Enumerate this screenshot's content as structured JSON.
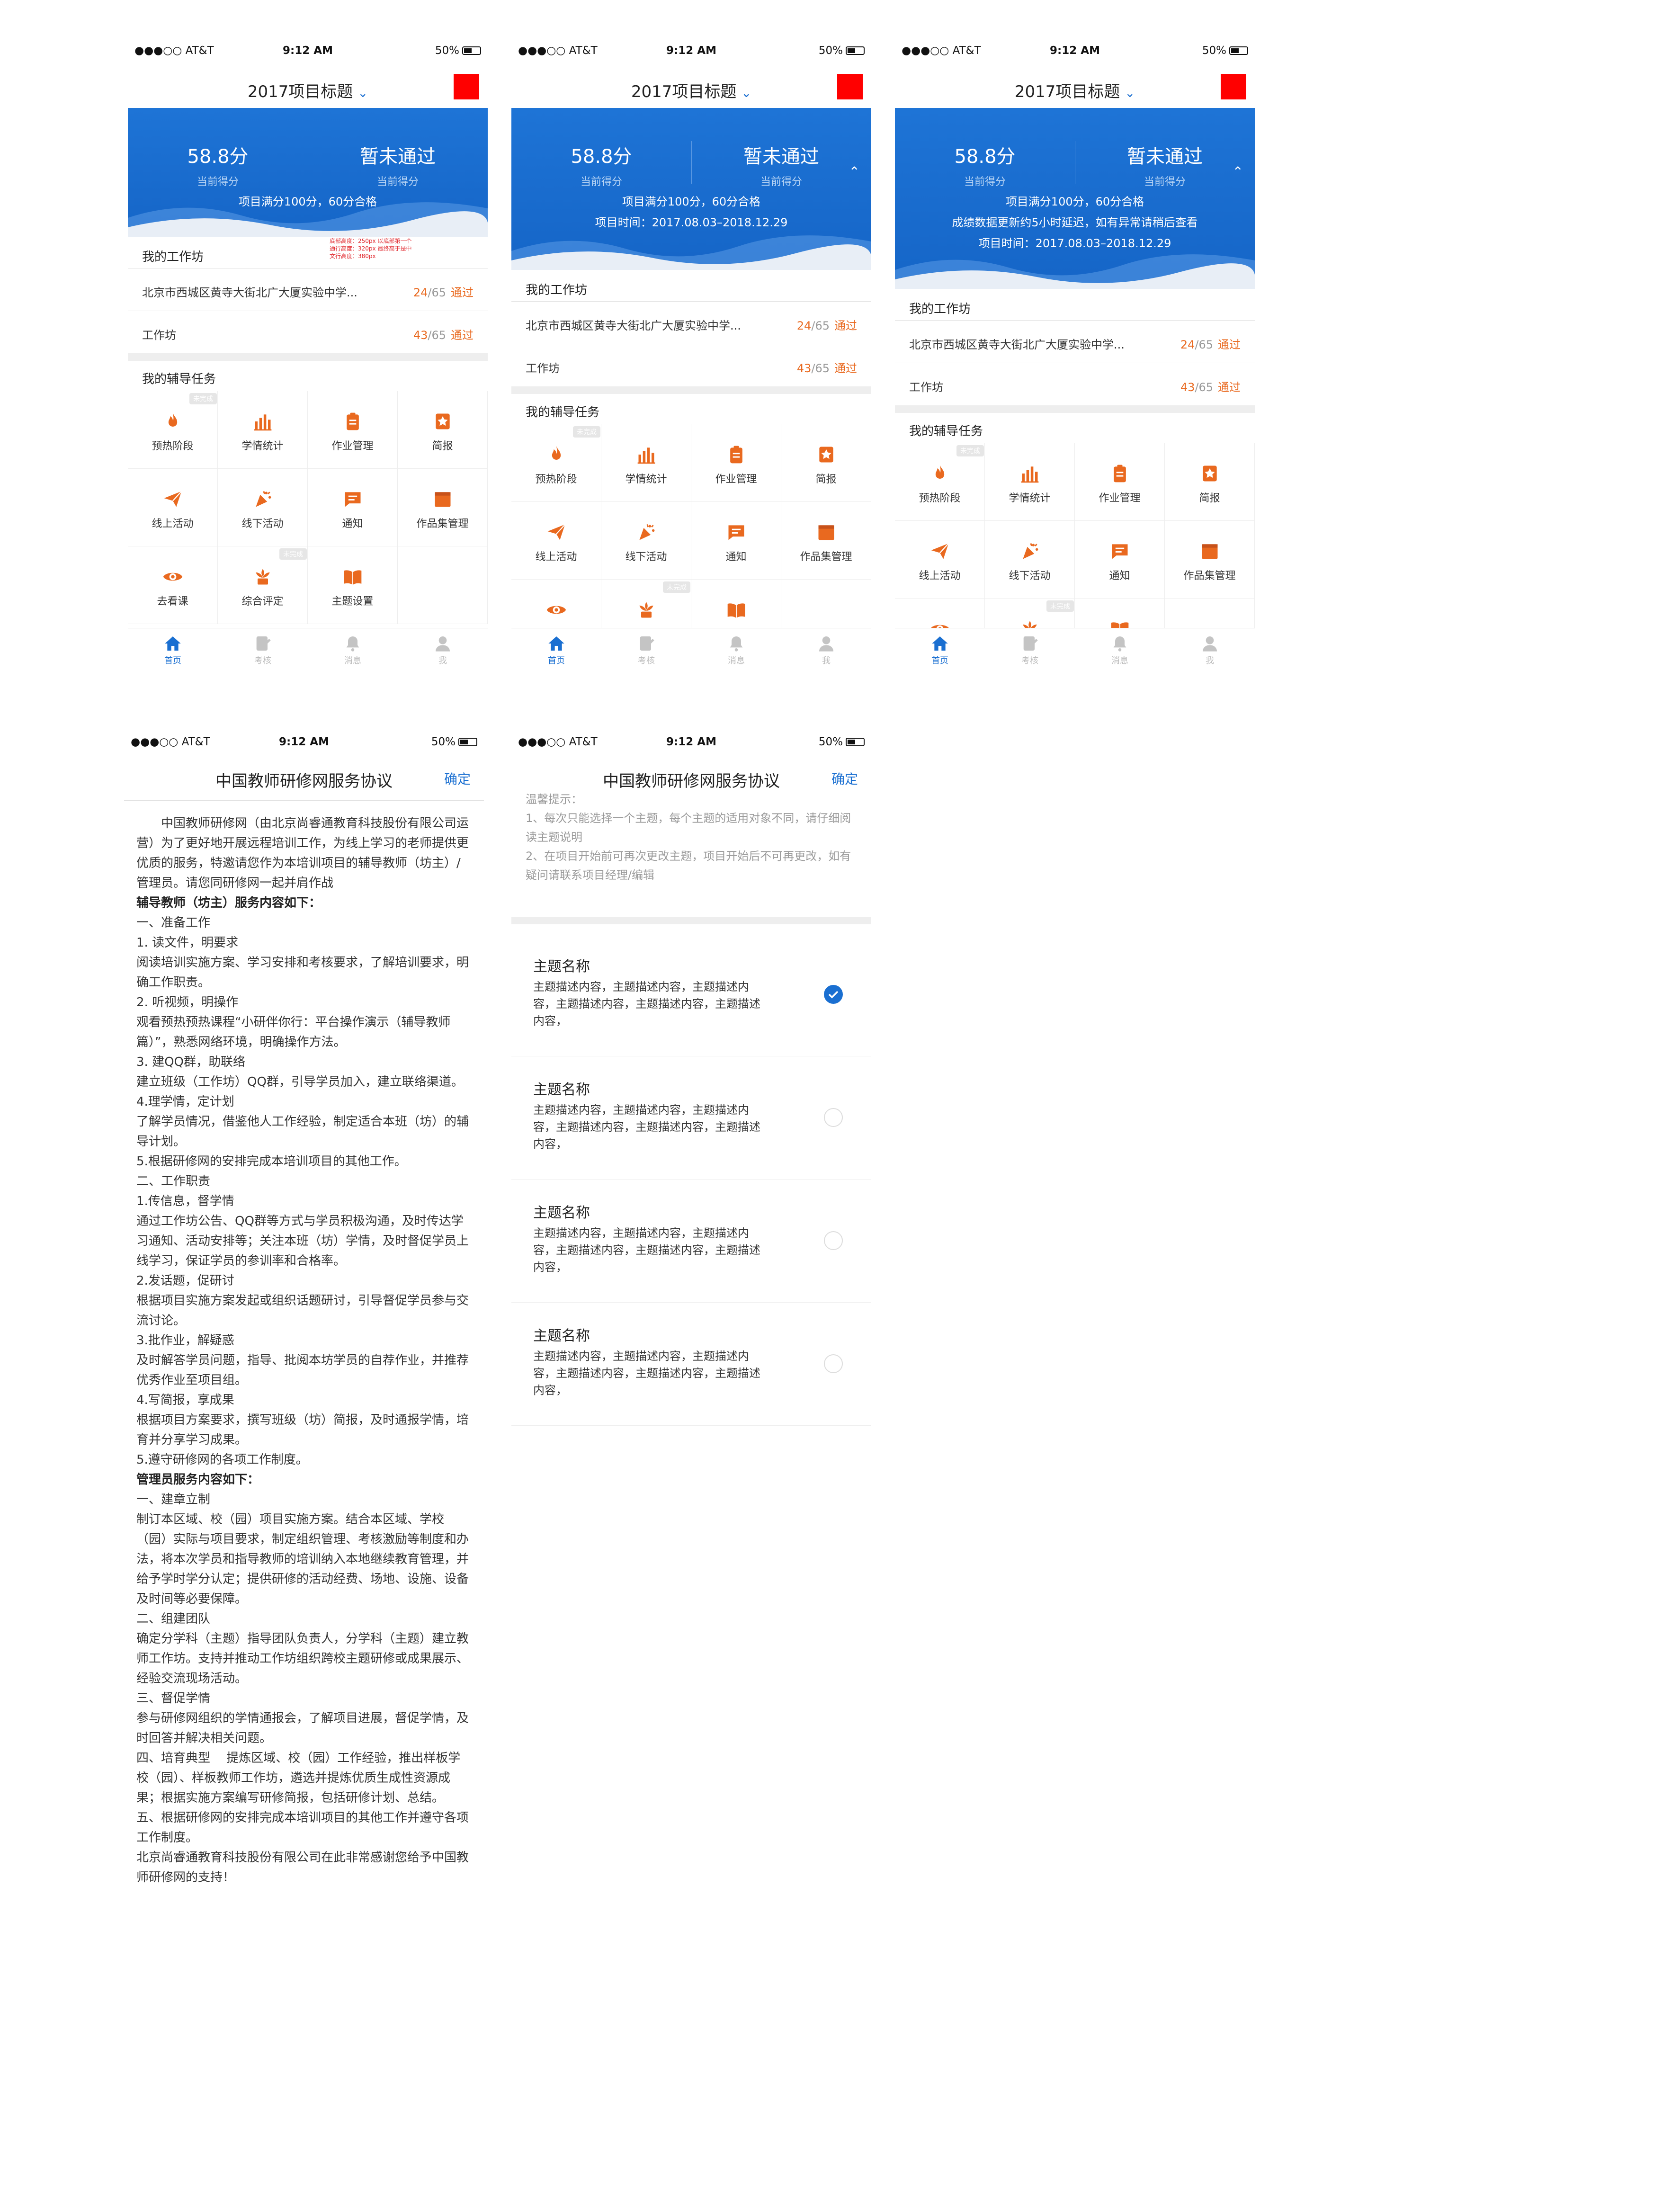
{
  "status": {
    "carrier": "●●●○○ AT&T",
    "time": "9:12 AM",
    "battery": "50%"
  },
  "home": {
    "title": "2017项目标题",
    "score_value": "58.8分",
    "score_label": "当前得分",
    "status_value": "暂未通过",
    "status_label": "当前得分",
    "info_full": "项目满分100分，60分合格",
    "info_time": "项目时间：2017.08.03–2018.12.29",
    "info_delay": "成绩数据更新约5小时延迟，如有异常请稍后查看",
    "workshop_title": "我的工作坊",
    "workshop_rows": [
      {
        "name": "北京市西城区黄寺大街北广大厦实验中学...",
        "score": "24",
        "total": "/65",
        "status": "通过"
      },
      {
        "name": "工作坊",
        "score": "43",
        "total": "/65",
        "status": "通过"
      }
    ],
    "tasks_title": "我的辅导任务",
    "tasks": [
      {
        "label": "预热阶段",
        "icon": "fire-icon"
      },
      {
        "label": "学情统计",
        "icon": "bar-chart-icon"
      },
      {
        "label": "作业管理",
        "icon": "clipboard-icon"
      },
      {
        "label": "简报",
        "icon": "star-bookmark-icon"
      },
      {
        "label": "线上活动",
        "icon": "paper-plane-icon"
      },
      {
        "label": "线下活动",
        "icon": "party-popper-icon"
      },
      {
        "label": "通知",
        "icon": "message-icon"
      },
      {
        "label": "作品集管理",
        "icon": "folder-icon"
      },
      {
        "label": "去看课",
        "icon": "eye-icon"
      },
      {
        "label": "综合评定",
        "icon": "flower-icon"
      },
      {
        "label": "主题设置",
        "icon": "book-icon"
      }
    ],
    "badge": "未完成",
    "tabs": [
      {
        "label": "首页",
        "icon": "home-icon"
      },
      {
        "label": "考核",
        "icon": "edit-icon"
      },
      {
        "label": "消息",
        "icon": "bell-icon"
      },
      {
        "label": "我",
        "icon": "user-icon"
      }
    ]
  },
  "agreement": {
    "title": "中国教师研修网服务协议",
    "confirm": "确定",
    "paragraphs": [
      {
        "text": "　　中国教师研修网（由北京尚睿通教育科技股份有限公司运营）为了更好地开展远程培训工作，为线上学习的老师提供更优质的服务，特邀请您作为本培训项目的辅导教师（坊主）/管理员。请您同研修网一起并肩作战",
        "bold": false
      },
      {
        "text": "辅导教师（坊主）服务内容如下：",
        "bold": true
      },
      {
        "text": "一、准备工作",
        "bold": false
      },
      {
        "text": "1. 读文件，明要求",
        "bold": false
      },
      {
        "text": "阅读培训实施方案、学习安排和考核要求，了解培训要求，明确工作职责。",
        "bold": false
      },
      {
        "text": "2. 听视频，明操作",
        "bold": false
      },
      {
        "text": "观看预热预热课程“小研伴你行：平台操作演示（辅导教师篇）”，熟悉网络环境，明确操作方法。",
        "bold": false
      },
      {
        "text": "3. 建QQ群，助联络",
        "bold": false
      },
      {
        "text": "建立班级（工作坊）QQ群，引导学员加入，建立联络渠道。",
        "bold": false
      },
      {
        "text": "4.理学情，定计划",
        "bold": false
      },
      {
        "text": "了解学员情况，借鉴他人工作经验，制定适合本班（坊）的辅导计划。",
        "bold": false
      },
      {
        "text": "5.根据研修网的安排完成本培训项目的其他工作。",
        "bold": false
      },
      {
        "text": "二、工作职责",
        "bold": false
      },
      {
        "text": "1.传信息，督学情",
        "bold": false
      },
      {
        "text": "通过工作坊公告、QQ群等方式与学员积极沟通，及时传达学习通知、活动安排等；关注本班（坊）学情，及时督促学员上线学习，保证学员的参训率和合格率。",
        "bold": false
      },
      {
        "text": "2.发话题，促研讨",
        "bold": false
      },
      {
        "text": "根据项目实施方案发起或组织话题研讨，引导督促学员参与交流讨论。",
        "bold": false
      },
      {
        "text": "3.批作业，解疑惑",
        "bold": false
      },
      {
        "text": "及时解答学员问题，指导、批阅本坊学员的自荐作业，并推荐优秀作业至项目组。",
        "bold": false
      },
      {
        "text": "4.写简报，享成果",
        "bold": false
      },
      {
        "text": "根据项目方案要求，撰写班级（坊）简报，及时通报学情，培育并分享学习成果。",
        "bold": false
      },
      {
        "text": "5.遵守研修网的各项工作制度。",
        "bold": false
      },
      {
        "text": "管理员服务内容如下：",
        "bold": true
      },
      {
        "text": "一、建章立制",
        "bold": false
      },
      {
        "text": "制订本区域、校（园）项目实施方案。结合本区域、学校（园）实际与项目要求，制定组织管理、考核激励等制度和办法，将本次学员和指导教师的培训纳入本地继续教育管理，并给予学时学分认定；提供研修的活动经费、场地、设施、设备及时间等必要保障。",
        "bold": false
      },
      {
        "text": "二、组建团队",
        "bold": false
      },
      {
        "text": "确定分学科（主题）指导团队负责人，分学科（主题）建立教师工作坊。支持并推动工作坊组织跨校主题研修或成果展示、经验交流现场活动。",
        "bold": false
      },
      {
        "text": "三、督促学情",
        "bold": false
      },
      {
        "text": "参与研修网组织的学情通报会，了解项目进展，督促学情，及时回答并解决相关问题。",
        "bold": false
      },
      {
        "text": "四、培育典型　 提炼区域、校（园）工作经验，推出样板学校（园）、样板教师工作坊，遴选并提炼优质生成性资源成果；根据实施方案编写研修简报，包括研修计划、总结。",
        "bold": false
      },
      {
        "text": "五、根据研修网的安排完成本培训项目的其他工作并遵守各项工作制度。",
        "bold": false
      },
      {
        "text": "北京尚睿通教育科技股份有限公司在此非常感谢您给予中国教师研修网的支持！",
        "bold": false
      }
    ]
  },
  "topics_screen": {
    "tips_title": "温馨提示：",
    "tips": [
      "1、每次只能选择一个主题，每个主题的适用对象不同，请仔细阅读主题说明",
      "2、在项目开始前可再次更改主题，项目开始后不可再更改，如有疑问请联系项目经理/编辑"
    ],
    "topics": [
      {
        "name": "主题名称",
        "desc": "主题描述内容，主题描述内容，主题描述内容，主题描述内容，主题描述内容，主题描述内容，",
        "checked": true
      },
      {
        "name": "主题名称",
        "desc": "主题描述内容，主题描述内容，主题描述内容，主题描述内容，主题描述内容，主题描述内容，",
        "checked": false
      },
      {
        "name": "主题名称",
        "desc": "主题描述内容，主题描述内容，主题描述内容，主题描述内容，主题描述内容，主题描述内容，",
        "checked": false
      },
      {
        "name": "主题名称",
        "desc": "主题描述内容，主题描述内容，主题描述内容，主题描述内容，主题描述内容，主题描述内容，",
        "checked": false
      }
    ]
  },
  "colors": {
    "brand_blue": "#1a6fd1",
    "accent_orange": "#e9691f",
    "marker_red": "#ff0000"
  }
}
